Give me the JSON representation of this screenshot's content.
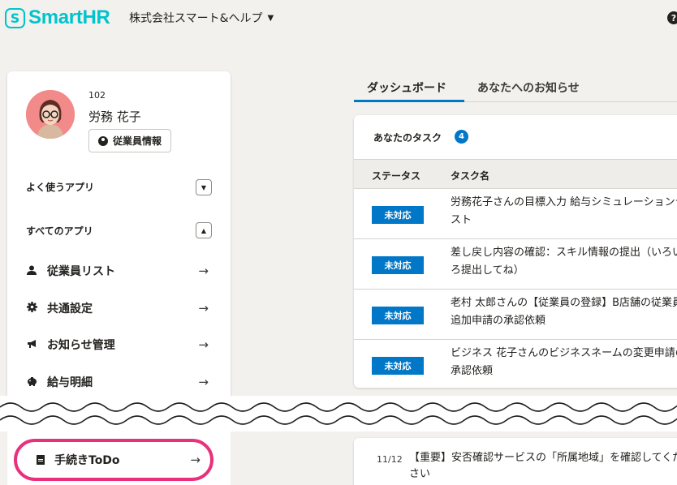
{
  "header": {
    "logo_mark": "S",
    "logo_text": "SmartHR",
    "company": "株式会社スマート&ヘルプ",
    "help_icon": "?"
  },
  "profile": {
    "employee_no": "102",
    "name": "労務 花子",
    "employee_info_button": "従業員情報"
  },
  "sections": {
    "favorite_apps": "よく使うアプリ",
    "all_apps": "すべてのアプリ"
  },
  "menu": [
    {
      "label": "従業員リスト",
      "icon": "person-icon"
    },
    {
      "label": "共通設定",
      "icon": "gear-icon"
    },
    {
      "label": "お知らせ管理",
      "icon": "megaphone-icon"
    },
    {
      "label": "給与明細",
      "icon": "payslip-icon"
    }
  ],
  "arrow": "→",
  "todo": {
    "label": "手続きToDo"
  },
  "tabs": [
    {
      "label": "ダッシュボード",
      "active": true
    },
    {
      "label": "あなたへのお知らせ",
      "active": false
    }
  ],
  "tasks": {
    "title": "あなたのタスク",
    "count": "4",
    "columns": [
      "ステータス",
      "タスク名"
    ],
    "rows": [
      {
        "status": "未対応",
        "name": "労務花子さんの目標入力 給与シミュレーションテスト"
      },
      {
        "status": "未対応",
        "name": "差し戻し内容の確認：スキル情報の提出（いろいろ提出してね）"
      },
      {
        "status": "未対応",
        "name": "老村 太郎さんの【従業員の登録】B店舗の従業員追加申請の承認依頼"
      },
      {
        "status": "未対応",
        "name": "ビジネス 花子さんのビジネスネームの変更申請の承認依頼"
      }
    ]
  },
  "notice": {
    "date": "11/12",
    "text": "【重要】安否確認サービスの「所属地域」を確認してください"
  },
  "colors": {
    "brand": "#00c4cc",
    "accent": "#0077c7",
    "highlight": "#e8317d"
  }
}
